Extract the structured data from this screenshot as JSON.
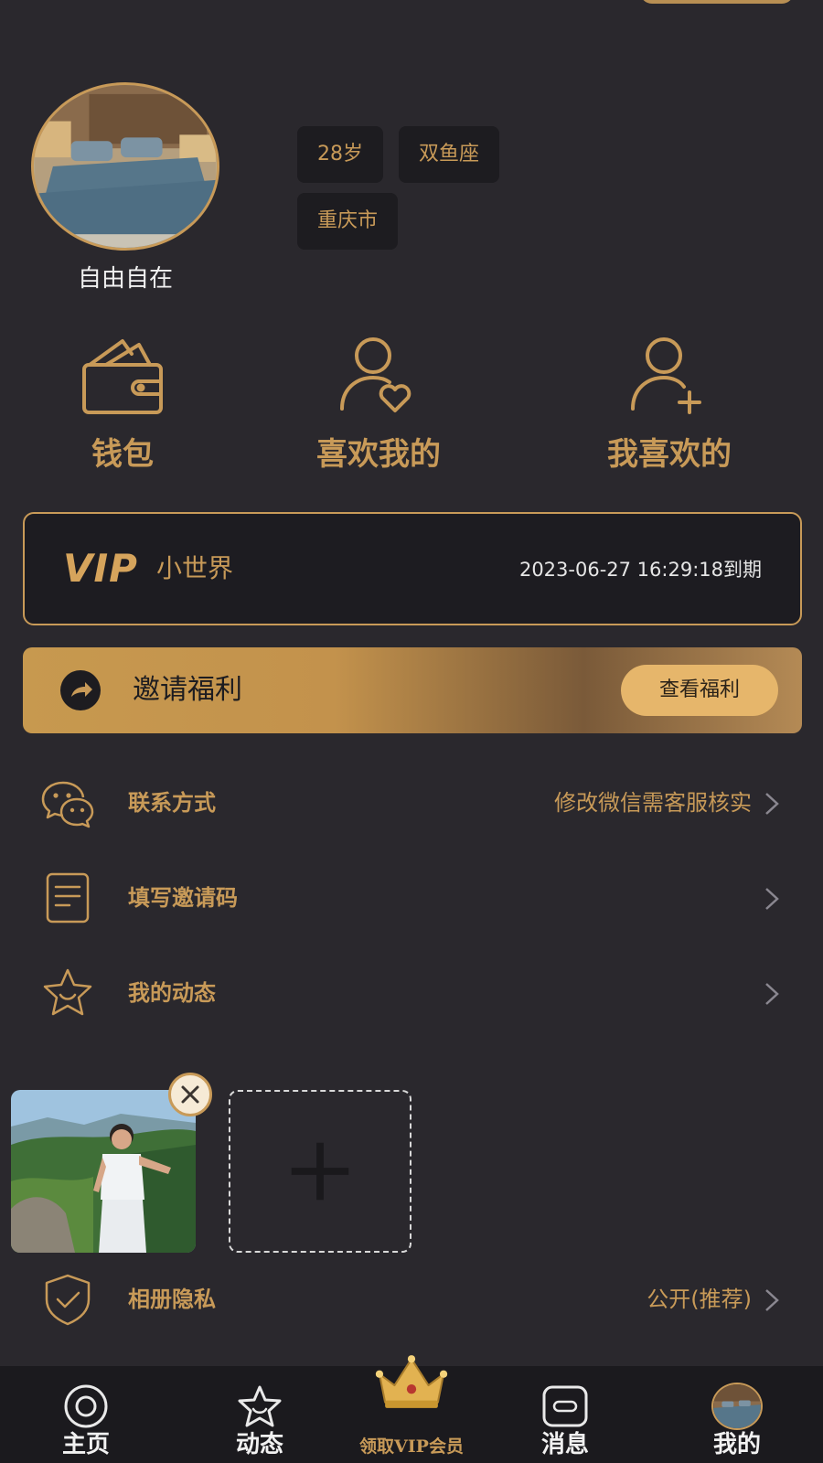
{
  "profile": {
    "nickname": "自由自在",
    "tags": [
      "28岁",
      "双鱼座",
      "重庆市"
    ]
  },
  "actions": [
    {
      "label": "钱包",
      "icon": "wallet-icon"
    },
    {
      "label": "喜欢我的",
      "icon": "user-heart-icon"
    },
    {
      "label": "我喜欢的",
      "icon": "user-plus-icon"
    }
  ],
  "vip": {
    "logo": "VIP",
    "name": "小世界",
    "expire": "2023-06-27 16:29:18到期"
  },
  "invite": {
    "title": "邀请福利",
    "button": "查看福利",
    "icon": "share-arrow-icon"
  },
  "menu": [
    {
      "label": "联系方式",
      "value": "修改微信需客服核实",
      "icon": "wechat-icon"
    },
    {
      "label": "填写邀请码",
      "value": "",
      "icon": "document-icon"
    },
    {
      "label": "我的动态",
      "value": "",
      "icon": "star-smile-icon"
    }
  ],
  "album_privacy": {
    "label": "相册隐私",
    "value": "公开(推荐)",
    "icon": "shield-check-icon"
  },
  "tabbar": [
    {
      "label": "主页",
      "icon": "home-circle-icon"
    },
    {
      "label": "动态",
      "icon": "star-icon"
    },
    {
      "label": "领取VIP会员",
      "icon": "crown-icon"
    },
    {
      "label": "消息",
      "icon": "message-icon"
    },
    {
      "label": "我的",
      "icon": "avatar-icon"
    }
  ],
  "colors": {
    "background": "#2a282d",
    "accent": "#c89a58",
    "card": "#1d1c20",
    "tabbar": "#1b1a1e"
  }
}
